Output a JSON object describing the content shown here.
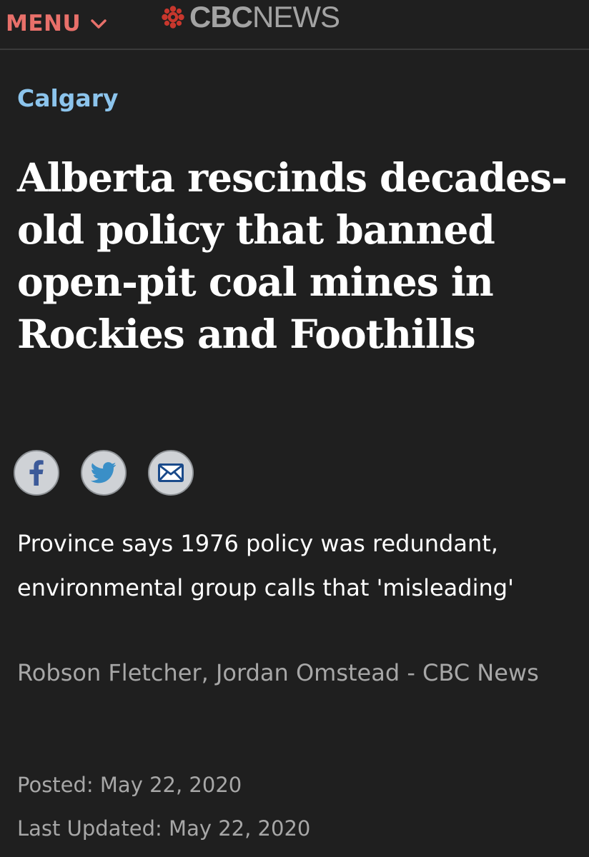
{
  "header": {
    "menu_label": "MENU",
    "menu_icon": "chevron-down-icon",
    "logo_icon": "cbc-gem-icon",
    "logo_bold": "CBC",
    "logo_light": "NEWS"
  },
  "article": {
    "section": "Calgary",
    "headline": "Alberta rescinds decades-old policy that banned open-pit coal mines in Rockies and Foothills",
    "share": [
      {
        "name": "facebook",
        "icon": "facebook-icon"
      },
      {
        "name": "twitter",
        "icon": "twitter-icon"
      },
      {
        "name": "email",
        "icon": "email-icon"
      }
    ],
    "deck": "Province says 1976 policy was redundant, environmental group calls that 'misleading'",
    "byline": "Robson Fletcher, Jordan Omstead - CBC News",
    "posted": "Posted: May 22, 2020",
    "updated": "Last Updated: May 22, 2020"
  },
  "colors": {
    "background": "#1f1f1f",
    "menu_accent": "#e8706a",
    "section_link": "#8cc4ec",
    "logo_gray": "#a3a3a3",
    "meta_gray": "#a7a7a7",
    "share_button": "#cfd2d6",
    "share_icon": "#3c5a99"
  }
}
